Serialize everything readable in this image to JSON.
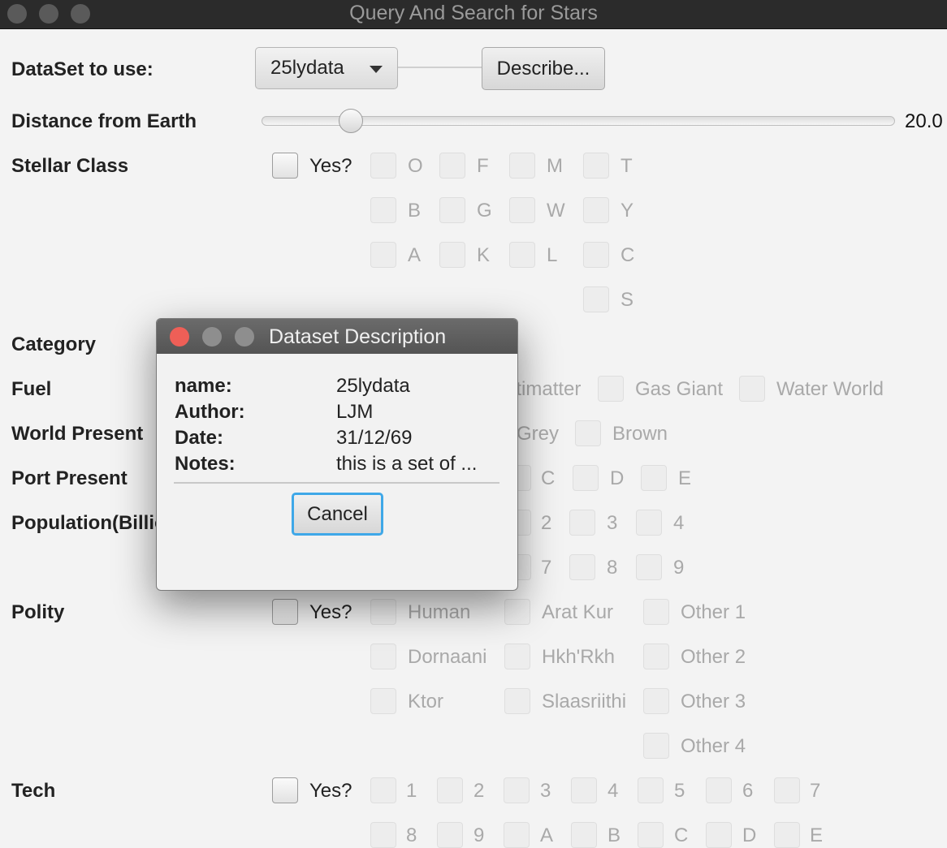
{
  "window": {
    "title": "Query And Search for Stars"
  },
  "dataset": {
    "label": "DataSet to use:",
    "selected": "25lydata",
    "describe_label": "Describe..."
  },
  "distance": {
    "label": "Distance from Earth",
    "value_text": "20.0",
    "slider_fraction": 0.14
  },
  "stellar": {
    "label": "Stellar Class",
    "yes": "Yes?",
    "options": [
      "O",
      "F",
      "M",
      "T",
      "B",
      "G",
      "W",
      "Y",
      "A",
      "K",
      "L",
      "C",
      "S"
    ]
  },
  "category": {
    "label": "Category"
  },
  "fuel": {
    "label": "Fuel",
    "options": [
      "Antimatter",
      "Gas Giant",
      "Water World"
    ]
  },
  "world": {
    "label": "World Present",
    "options": [
      "Grey",
      "Brown"
    ]
  },
  "port": {
    "label": "Port Present",
    "options": [
      "C",
      "D",
      "E"
    ]
  },
  "population": {
    "label": "Population(Billions)",
    "options": [
      "2",
      "3",
      "4",
      "7",
      "8",
      "9"
    ]
  },
  "polity": {
    "label": "Polity",
    "yes": "Yes?",
    "options": [
      "Human",
      "Arat Kur",
      "Other 1",
      "Dornaani",
      "Hkh'Rkh",
      "Other 2",
      "Ktor",
      "Slaasriithi",
      "Other 3",
      "Other 4"
    ]
  },
  "tech": {
    "label": "Tech",
    "yes": "Yes?",
    "options": [
      "1",
      "2",
      "3",
      "4",
      "5",
      "6",
      "7",
      "8",
      "9",
      "A",
      "B",
      "C",
      "D",
      "E"
    ]
  },
  "dialog": {
    "title": "Dataset Description",
    "fields": [
      {
        "key": "name:",
        "value": "25lydata"
      },
      {
        "key": "Author:",
        "value": "LJM"
      },
      {
        "key": "Date:",
        "value": "31/12/69"
      },
      {
        "key": "Notes:",
        "value": "this is a set of ..."
      }
    ],
    "cancel_label": "Cancel"
  },
  "colors": {
    "window_bar": "#2b2b2b",
    "dialog_close": "#ee5f57",
    "focus_ring": "#3fa8e8",
    "disabled_text": "#a9a9a9"
  }
}
